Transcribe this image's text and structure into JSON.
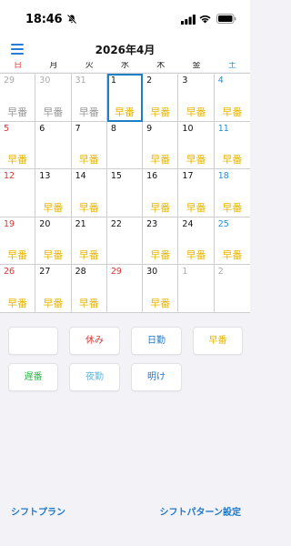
{
  "status": {
    "time": "18:46"
  },
  "nav": {
    "title": "2026年4月"
  },
  "weekdays": [
    {
      "label": "日",
      "kind": "sun"
    },
    {
      "label": "月",
      "kind": ""
    },
    {
      "label": "火",
      "kind": ""
    },
    {
      "label": "水",
      "kind": ""
    },
    {
      "label": "木",
      "kind": ""
    },
    {
      "label": "金",
      "kind": ""
    },
    {
      "label": "土",
      "kind": "sat"
    }
  ],
  "days": [
    {
      "day": "29",
      "type": "other",
      "shift": "早番",
      "shiftType": "other"
    },
    {
      "day": "30",
      "type": "other",
      "shift": "早番",
      "shiftType": "other"
    },
    {
      "day": "31",
      "type": "other",
      "shift": "早番",
      "shiftType": "other"
    },
    {
      "day": "1",
      "type": "",
      "shift": "早番",
      "today": true
    },
    {
      "day": "2",
      "type": "",
      "shift": "早番"
    },
    {
      "day": "3",
      "type": "",
      "shift": "早番"
    },
    {
      "day": "4",
      "type": "sat",
      "shift": "早番"
    },
    {
      "day": "5",
      "type": "sun",
      "shift": "早番"
    },
    {
      "day": "6",
      "type": "",
      "shift": ""
    },
    {
      "day": "7",
      "type": "",
      "shift": "早番"
    },
    {
      "day": "8",
      "type": "",
      "shift": ""
    },
    {
      "day": "9",
      "type": "",
      "shift": "早番"
    },
    {
      "day": "10",
      "type": "",
      "shift": "早番"
    },
    {
      "day": "11",
      "type": "sat",
      "shift": "早番"
    },
    {
      "day": "12",
      "type": "sun",
      "shift": ""
    },
    {
      "day": "13",
      "type": "",
      "shift": "早番"
    },
    {
      "day": "14",
      "type": "",
      "shift": "早番"
    },
    {
      "day": "15",
      "type": "",
      "shift": ""
    },
    {
      "day": "16",
      "type": "",
      "shift": "早番"
    },
    {
      "day": "17",
      "type": "",
      "shift": "早番"
    },
    {
      "day": "18",
      "type": "sat",
      "shift": "早番"
    },
    {
      "day": "19",
      "type": "sun",
      "shift": "早番"
    },
    {
      "day": "20",
      "type": "",
      "shift": "早番"
    },
    {
      "day": "21",
      "type": "",
      "shift": "早番"
    },
    {
      "day": "22",
      "type": "",
      "shift": ""
    },
    {
      "day": "23",
      "type": "",
      "shift": "早番"
    },
    {
      "day": "24",
      "type": "",
      "shift": "早番"
    },
    {
      "day": "25",
      "type": "sat",
      "shift": "早番"
    },
    {
      "day": "26",
      "type": "sun",
      "shift": "早番"
    },
    {
      "day": "27",
      "type": "",
      "shift": "早番"
    },
    {
      "day": "28",
      "type": "",
      "shift": "早番"
    },
    {
      "day": "29",
      "type": "holiday",
      "shift": ""
    },
    {
      "day": "30",
      "type": "",
      "shift": "早番"
    },
    {
      "day": "1",
      "type": "other",
      "shift": ""
    },
    {
      "day": "2",
      "type": "other",
      "shift": ""
    }
  ],
  "palette": {
    "blank": {
      "label": "",
      "color": "#333333"
    },
    "off": {
      "label": "休み",
      "color": "#d63a3a"
    },
    "day": {
      "label": "日勤",
      "color": "#1e78c8"
    },
    "early": {
      "label": "早番",
      "color": "#e8b600"
    },
    "late": {
      "label": "遅番",
      "color": "#2fb84a"
    },
    "night": {
      "label": "夜勤",
      "color": "#5fb6d8"
    },
    "after": {
      "label": "明け",
      "color": "#1e78c8"
    }
  },
  "footer": {
    "left": "シフトプラン",
    "right": "シフトパターン設定"
  }
}
